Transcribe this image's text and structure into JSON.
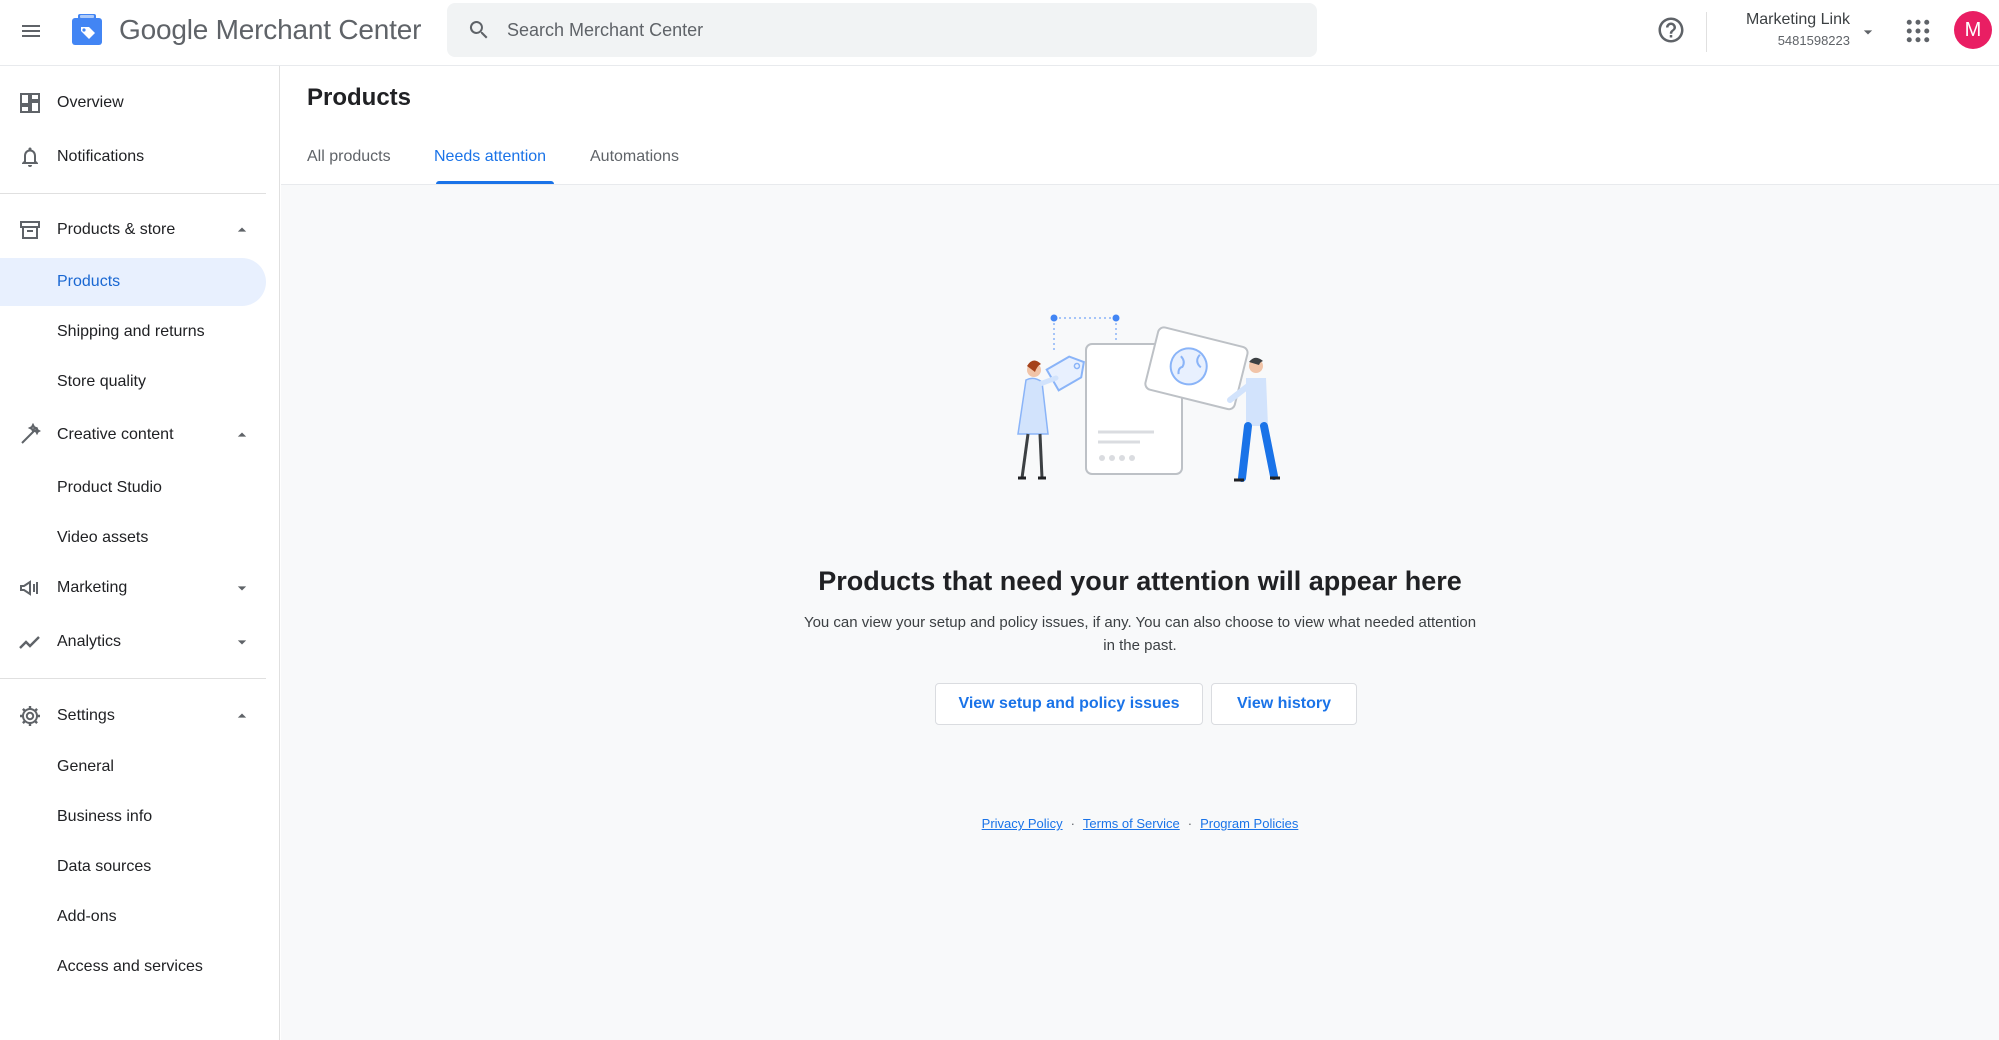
{
  "app": {
    "title": "Google Merchant Center",
    "search_placeholder": "Search Merchant Center"
  },
  "account": {
    "name": "Marketing Link",
    "id": "5481598223",
    "avatar_letter": "M",
    "avatar_color": "#e91e63"
  },
  "sidebar": {
    "overview": "Overview",
    "notifications": "Notifications",
    "products_store": "Products & store",
    "products": "Products",
    "shipping": "Shipping and returns",
    "store_quality": "Store quality",
    "creative_content": "Creative content",
    "product_studio": "Product Studio",
    "video_assets": "Video assets",
    "marketing": "Marketing",
    "analytics": "Analytics",
    "settings": "Settings",
    "general": "General",
    "business_info": "Business info",
    "data_sources": "Data sources",
    "add_ons": "Add-ons",
    "access_services": "Access and services"
  },
  "main": {
    "page_title": "Products",
    "tabs": [
      {
        "label": "All products"
      },
      {
        "label": "Needs attention"
      },
      {
        "label": "Automations"
      }
    ],
    "active_tab": "Needs attention",
    "empty_title": "Products that need your attention will appear here",
    "empty_description": "You can view your setup and policy issues, if any. You can also choose to view what needed attention in the past.",
    "btn_setup": "View setup and policy issues",
    "btn_history": "View history"
  },
  "footer": {
    "privacy": "Privacy Policy",
    "terms": "Terms of Service",
    "policies": "Program Policies",
    "separator": "·"
  },
  "colors": {
    "accent": "#1a73e8",
    "active_bg": "#e8f0fe",
    "main_bg": "#f8f9fa"
  }
}
